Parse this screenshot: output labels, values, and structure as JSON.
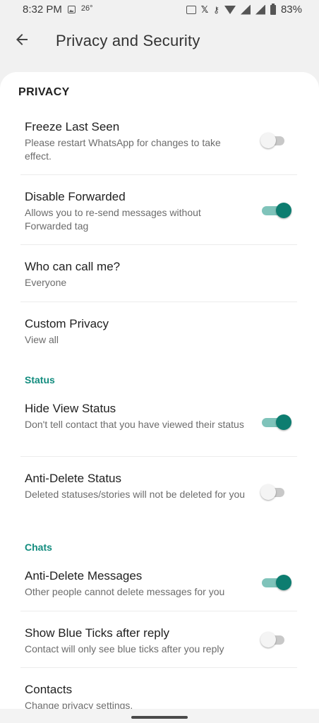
{
  "status_bar": {
    "time": "8:32 PM",
    "temperature": "26°",
    "battery": "83%",
    "icons": [
      "image-icon",
      "nfc-icon",
      "x-icon",
      "key-icon",
      "wifi-icon",
      "signal-icon",
      "signal-icon",
      "battery-icon"
    ]
  },
  "toolbar": {
    "title": "Privacy and Security",
    "back_icon": "arrow-left-icon"
  },
  "privacy": {
    "header": "PRIVACY",
    "freeze_last_seen": {
      "title": "Freeze Last Seen",
      "subtitle": "Please restart WhatsApp for changes to take effect.",
      "enabled": false
    },
    "disable_forwarded": {
      "title": "Disable Forwarded",
      "subtitle": "Allows you to re-send messages without Forwarded tag",
      "enabled": true
    },
    "who_can_call": {
      "title": "Who can call me?",
      "subtitle": "Everyone"
    },
    "custom_privacy": {
      "title": "Custom Privacy",
      "subtitle": "View all"
    }
  },
  "status": {
    "header": "Status",
    "hide_view_status": {
      "title": "Hide View Status",
      "subtitle": "Don't tell contact that you have viewed their status",
      "enabled": true
    },
    "anti_delete_status": {
      "title": "Anti-Delete Status",
      "subtitle": "Deleted statuses/stories will not be deleted for you",
      "enabled": false
    }
  },
  "chats": {
    "header": "Chats",
    "anti_delete_messages": {
      "title": "Anti-Delete Messages",
      "subtitle": "Other people cannot delete messages for you",
      "enabled": true
    },
    "show_blue_ticks": {
      "title": "Show Blue Ticks after reply",
      "subtitle": "Contact will only see blue ticks after you reply",
      "enabled": false
    },
    "contacts": {
      "title": "Contacts",
      "subtitle": "Change privacy settings."
    }
  },
  "colors": {
    "accent": "#128c7e",
    "switch_on": "#0d7d70",
    "background": "#f1f1f1"
  }
}
